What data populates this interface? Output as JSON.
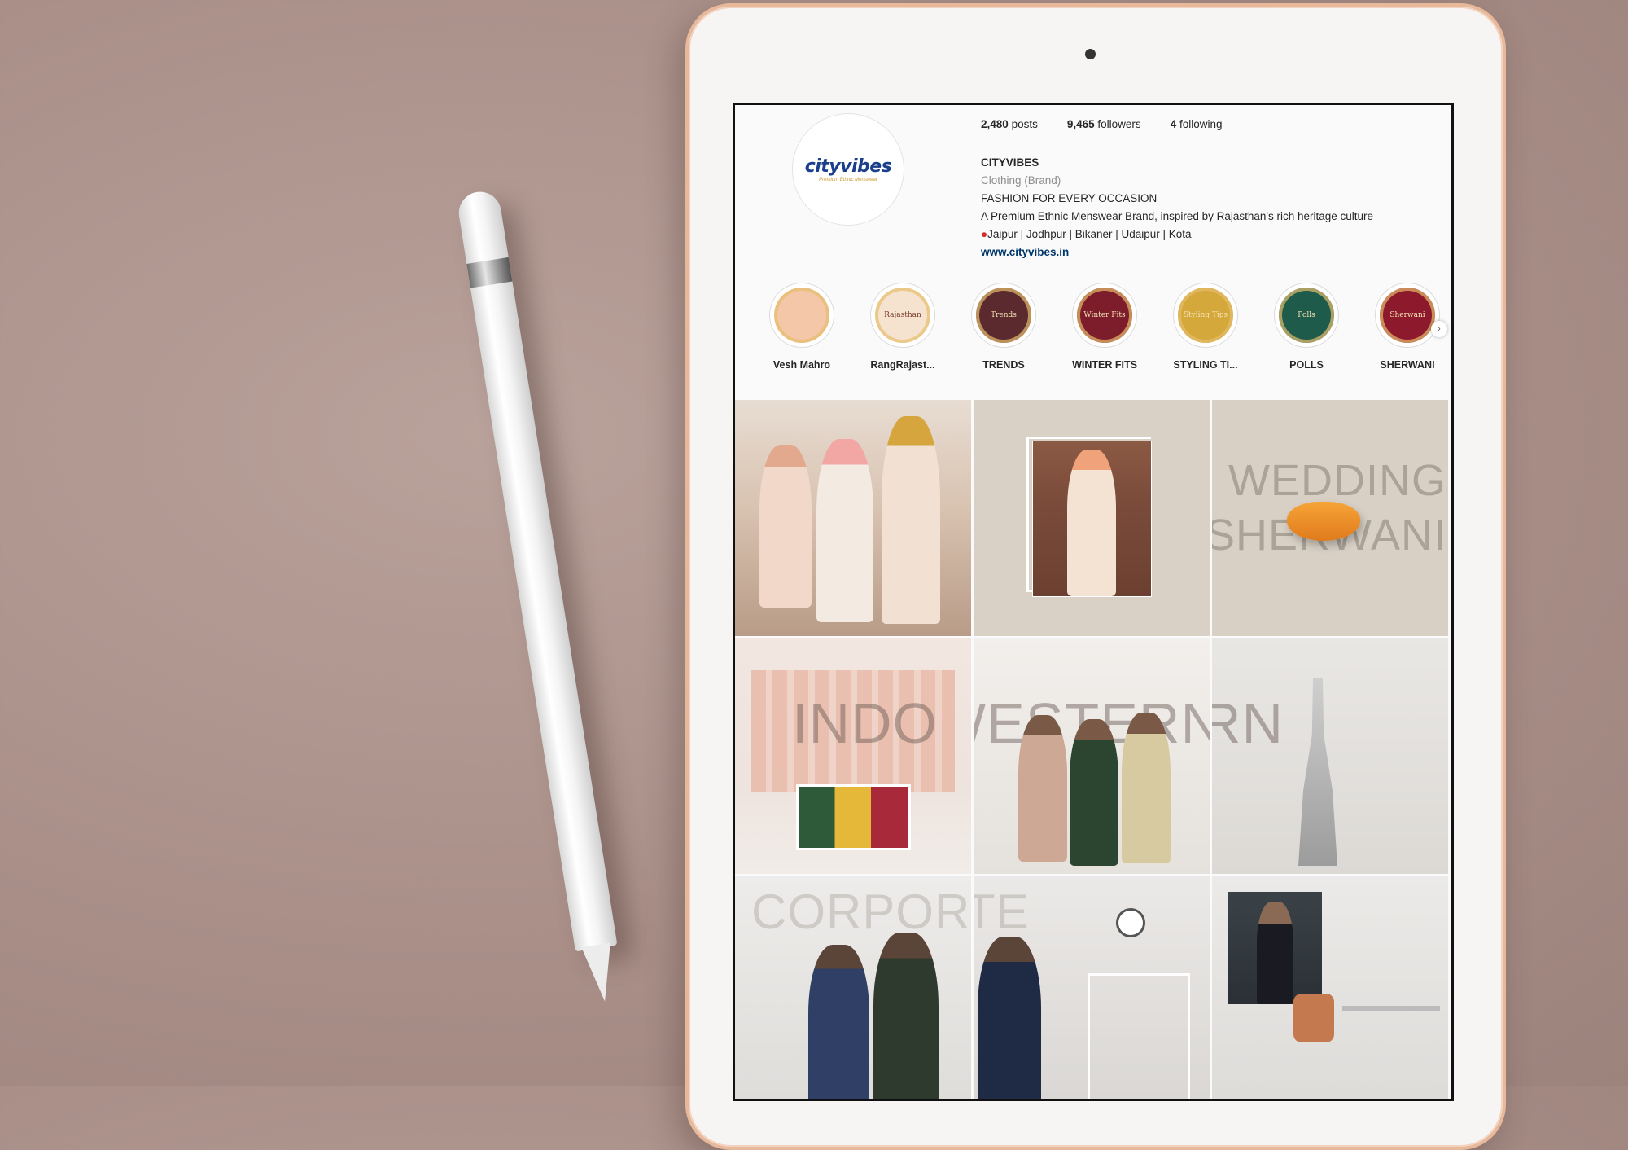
{
  "profile": {
    "logo_text": "cityvibes",
    "logo_tagline": "Premium Ethnic Menswear",
    "stats": {
      "posts": "2,480",
      "posts_label": "posts",
      "followers": "9,465",
      "followers_label": "followers",
      "following": "4",
      "following_label": "following"
    },
    "name": "CITYVIBES",
    "category": "Clothing (Brand)",
    "bio_line1": "FASHION FOR EVERY OCCASION",
    "bio_line2": "A Premium Ethnic Menswear Brand, inspired by Rajasthan's rich heritage culture",
    "bio_line3": "Jaipur | Jodhpur | Bikaner | Udaipur | Kota",
    "website": "www.cityvibes.in"
  },
  "highlights": [
    {
      "label": "Vesh Mahro",
      "inner": "",
      "color": "#f3c7a8"
    },
    {
      "label": "RangRajast...",
      "inner": "Rajasthan",
      "color": "#f5e3cf"
    },
    {
      "label": "TRENDS",
      "inner": "Trends",
      "color": "#5a2a2e"
    },
    {
      "label": "WINTER FITS",
      "inner": "Winter Fits",
      "color": "#7d1c2a"
    },
    {
      "label": "STYLING TI...",
      "inner": "Styling Tips",
      "color": "#d4a83a"
    },
    {
      "label": "POLLS",
      "inner": "Polls",
      "color": "#1f5b4a"
    },
    {
      "label": "SHERWANI",
      "inner": "Sherwani",
      "color": "#8c1a2c"
    }
  ],
  "posts": {
    "wedding_word1": "WEDDING",
    "wedding_word2": "SHERWANI",
    "indowestern_word": "INDOWESTERN",
    "corporate_word": "CORPORATE"
  },
  "colors": {
    "frame": "#e8b89a",
    "link": "#00376b",
    "text": "#262626",
    "muted": "#8e8e8e"
  }
}
